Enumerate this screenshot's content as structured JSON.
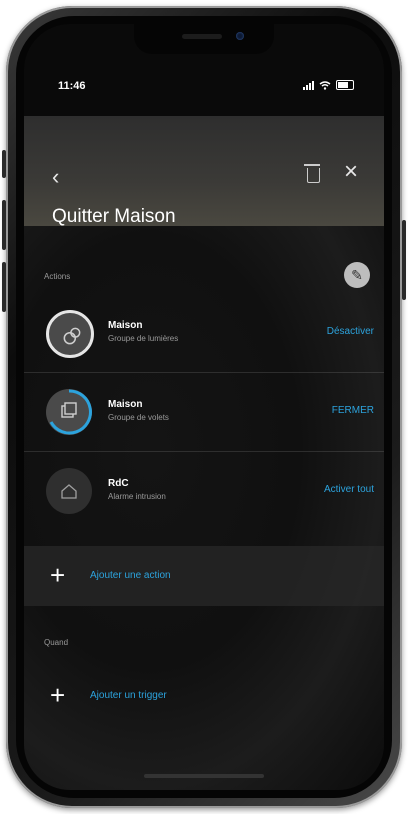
{
  "status_bar": {
    "time": "11:46"
  },
  "header": {
    "back_icon": "chevron-left",
    "delete_icon": "trash",
    "close_icon": "close",
    "title": "Quitter Maison"
  },
  "actions_section": {
    "label": "Actions",
    "edit_icon": "pencil",
    "items": [
      {
        "title": "Maison",
        "subtitle": "Groupe de lumières",
        "action": "Désactiver",
        "icon": "lights"
      },
      {
        "title": "Maison",
        "subtitle": "Groupe de volets",
        "action": "FERMER",
        "icon": "shutters"
      },
      {
        "title": "RdC",
        "subtitle": "Alarme intrusion",
        "action": "Activer tout",
        "icon": "house"
      }
    ],
    "add_label": "Ajouter une action"
  },
  "when_section": {
    "label": "Quand",
    "add_label": "Ajouter un trigger"
  },
  "colors": {
    "accent": "#2ca3dd",
    "background": "#0a0a0a",
    "header": "#3b3a37"
  }
}
